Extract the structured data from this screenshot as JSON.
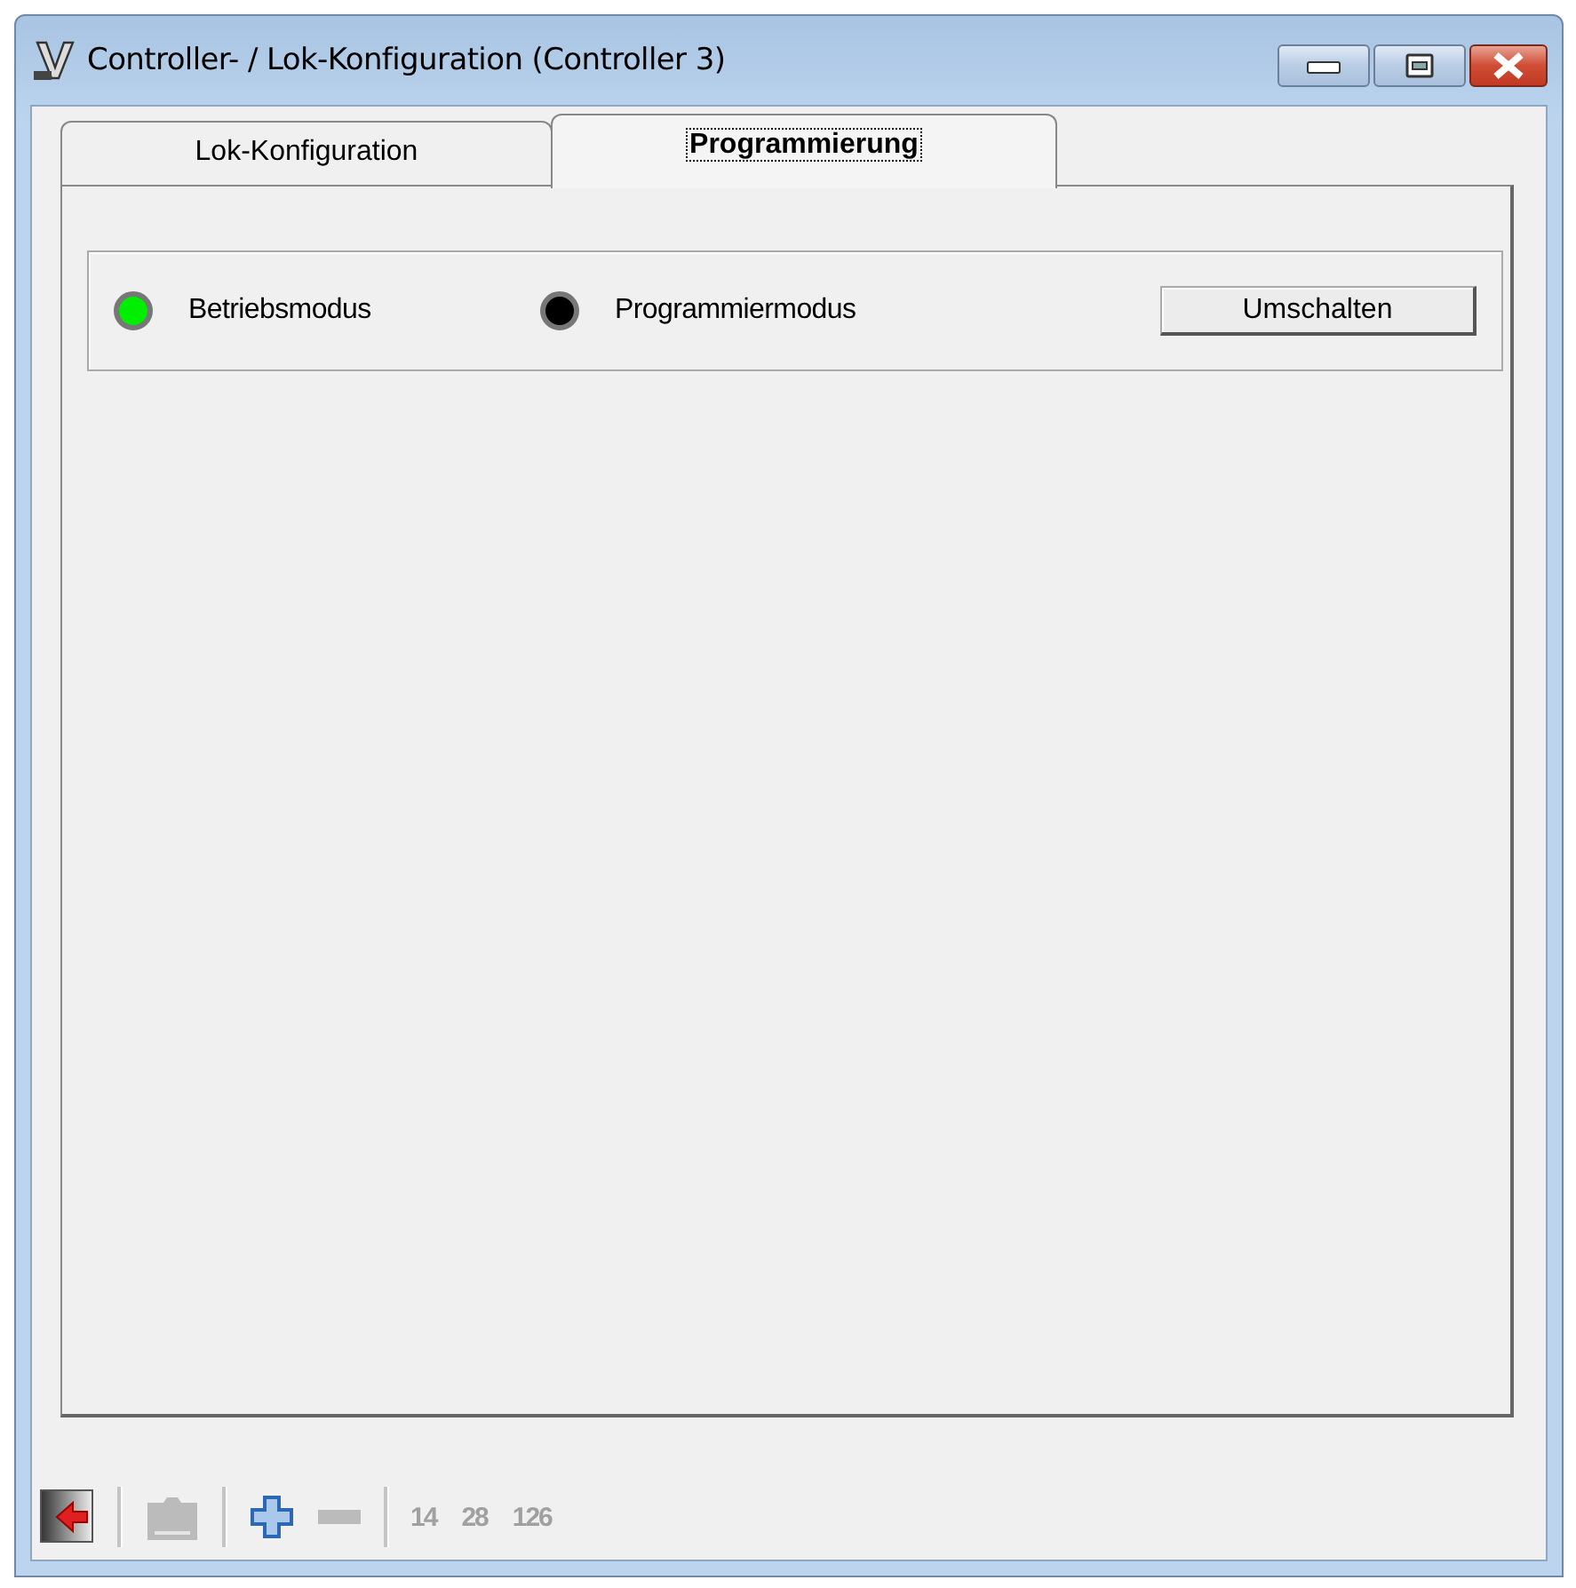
{
  "window": {
    "title": "Controller- / Lok-Konfiguration (Controller 3)"
  },
  "tabs": [
    {
      "label": "Lok-Konfiguration",
      "selected": false
    },
    {
      "label": "Programmierung",
      "selected": true
    }
  ],
  "mode_group": {
    "indicators": [
      {
        "label": "Betriebsmodus",
        "color": "#00ee00"
      },
      {
        "label": "Programmiermodus",
        "color": "#000000"
      }
    ],
    "button": "Umschalten"
  },
  "toolbar": [
    {
      "kind": "exit-icon",
      "disabled": false
    },
    {
      "kind": "separator"
    },
    {
      "kind": "folder-icon",
      "disabled": true
    },
    {
      "kind": "separator"
    },
    {
      "kind": "plus-icon",
      "disabled": false
    },
    {
      "kind": "minus-icon",
      "disabled": true
    },
    {
      "kind": "separator"
    },
    {
      "kind": "text",
      "label": "14",
      "disabled": true
    },
    {
      "kind": "text",
      "label": "28",
      "disabled": true
    },
    {
      "kind": "text",
      "label": "126",
      "disabled": true
    }
  ]
}
